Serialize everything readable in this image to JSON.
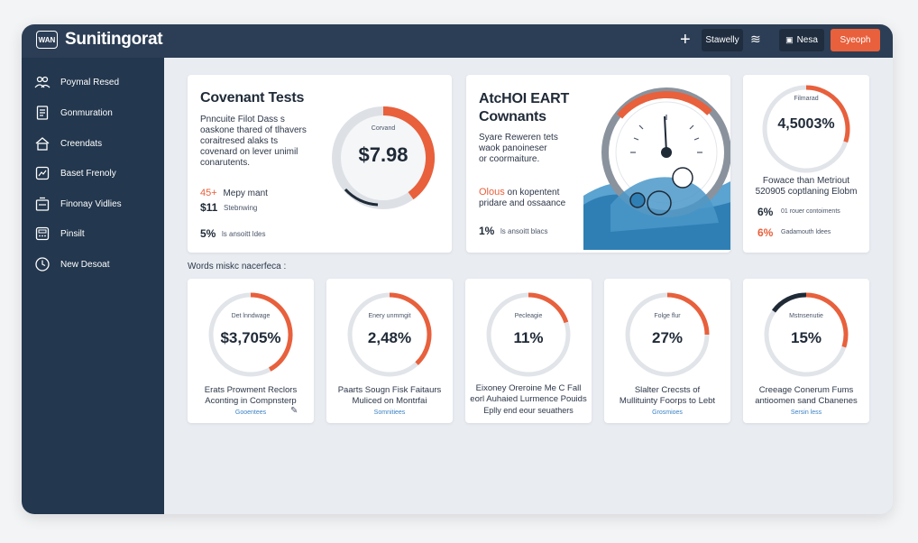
{
  "app": {
    "logo_text": "WAN",
    "title": "Sunitingorat"
  },
  "toolbar": {
    "plus": "+",
    "btn1": "Stawelly",
    "icon2": "≋",
    "btn3": "Nesa",
    "btn4": "Syeoph"
  },
  "sidebar": {
    "items": [
      {
        "label": "Poymal Resed",
        "icon": "people-icon"
      },
      {
        "label": "Gonmuration",
        "icon": "document-icon"
      },
      {
        "label": "Creendats",
        "icon": "house-icon"
      },
      {
        "label": "Baset Frenoly",
        "icon": "chart-box-icon"
      },
      {
        "label": "Finonay Vidlies",
        "icon": "inbox-icon"
      },
      {
        "label": "Pinsilt",
        "icon": "calculator-icon"
      },
      {
        "label": "New Desoat",
        "icon": "clock-icon"
      }
    ]
  },
  "cards": {
    "covenant": {
      "title": "Covenant Tests",
      "desc": [
        "Pnncuite Filot Dass s",
        "oaskone thared of tlhavers",
        "coraitresed alaks ts",
        "covenard on lever unimil",
        "conarutents."
      ],
      "row1_pct": "45+",
      "row1_text": "Mepy mant",
      "row2_val": "$11",
      "row2_text": "Stebnwing",
      "row3_val": "5%",
      "row3_text": "ls ansoitt ldes",
      "gauge_label": "Corvand",
      "gauge_value": "$7.98",
      "gauge_fraction": 0.4
    },
    "atchoi": {
      "title_line1": "AtcHOI EART",
      "title_line2": "Cownants",
      "desc": [
        "Syare Reweren tets",
        "waok panoineser",
        "or coormaiture."
      ],
      "orange_text": "Olous",
      "orange_rest": " on kopentent",
      "line2": "pridare and ossaance",
      "foot_val": "1%",
      "foot_text": "ls ansoitt blacs"
    },
    "filmarad": {
      "gauge_label": "Filmarad",
      "gauge_value": "4,5003%",
      "gauge_fraction": 0.3,
      "desc": [
        "Fowace than Metriout",
        "520905 coptlaning Elobm"
      ],
      "row1_val": "6%",
      "row1_text": "01 rouer contoiments",
      "row2_val": "6%",
      "row2_text": "Gadamouth ldees"
    }
  },
  "section_label": "Words miskc nacerfeca :",
  "mini_cards": [
    {
      "label": "Det lnndwage",
      "value": "$3,705%",
      "fraction": 0.42,
      "desc": [
        "Erats Prowment Reclors",
        "Aconting in Compnsterp"
      ],
      "link": "Gooentees"
    },
    {
      "label": "Enery unmmgit",
      "value": "2,48%",
      "fraction": 0.38,
      "desc": [
        "Paarts Sougn Fisk Faitaurs",
        "Muliced on Montrfai"
      ],
      "link": "Somnitiees"
    },
    {
      "label": "Pecleagie",
      "value": "11%",
      "fraction": 0.2,
      "desc": [
        "Eixoney Oreroine Me C Fall",
        "eorl Auhaied Lurmence Pouids",
        "Eplly end eour seuathers"
      ],
      "link": ""
    },
    {
      "label": "Folge flur",
      "value": "27%",
      "fraction": 0.25,
      "desc": [
        "Slalter Crecsts of",
        "Mullituinty Foorps to Lebt"
      ],
      "link": "Grosmioes"
    },
    {
      "label": "Mstnsenutie",
      "value": "15%",
      "fraction": 0.3,
      "desc": [
        "Creeage Conerum Fums",
        "antioomen sand Cbanenes"
      ],
      "link": "Sersin less"
    }
  ],
  "colors": {
    "accent": "#e8603c",
    "navy": "#23374e",
    "topbar": "#2c3e55",
    "link": "#3b82c4"
  }
}
